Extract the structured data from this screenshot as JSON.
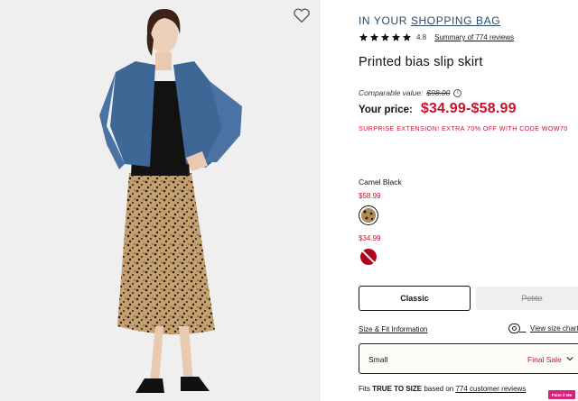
{
  "header": {
    "bag_prefix": "IN YOUR",
    "bag_link": "SHOPPING BAG"
  },
  "rating": {
    "value": "4.8",
    "stars": 5,
    "reviews_link": "Summary of 774 reviews"
  },
  "product": {
    "title": "Printed bias slip skirt",
    "comparable_label": "Comparable value:",
    "comparable_price": "$98.00",
    "price_label": "Your price:",
    "price_range": "$34.99-$58.99",
    "promo": "SURPRISE EXTENSION! EXTRA 70% OFF WITH CODE WOW70"
  },
  "colors": {
    "selected_name": "Camel Black",
    "options": [
      {
        "price": "$58.99",
        "icon": "leopard-swatch",
        "color": "#b08a58"
      },
      {
        "price": "$34.99",
        "icon": "unavailable-red-swatch",
        "color": "#b3001b"
      }
    ]
  },
  "fit": {
    "classic": "Classic",
    "petite": "Petite"
  },
  "size": {
    "info_link": "Size & Fit Information",
    "chart_link": "View size chart",
    "selected": "Small",
    "final_sale": "Final Sale"
  },
  "fit_note": {
    "prefix": "Fits",
    "emphasis": "TRUE TO SIZE",
    "middle": "based on",
    "link": "774 customer reviews"
  },
  "badge": {
    "label": "Paint it Me"
  },
  "theme": {
    "accent_red": "#c8102e",
    "bag_blue": "#2a4a66",
    "select_bg": "#fdfbf5"
  }
}
